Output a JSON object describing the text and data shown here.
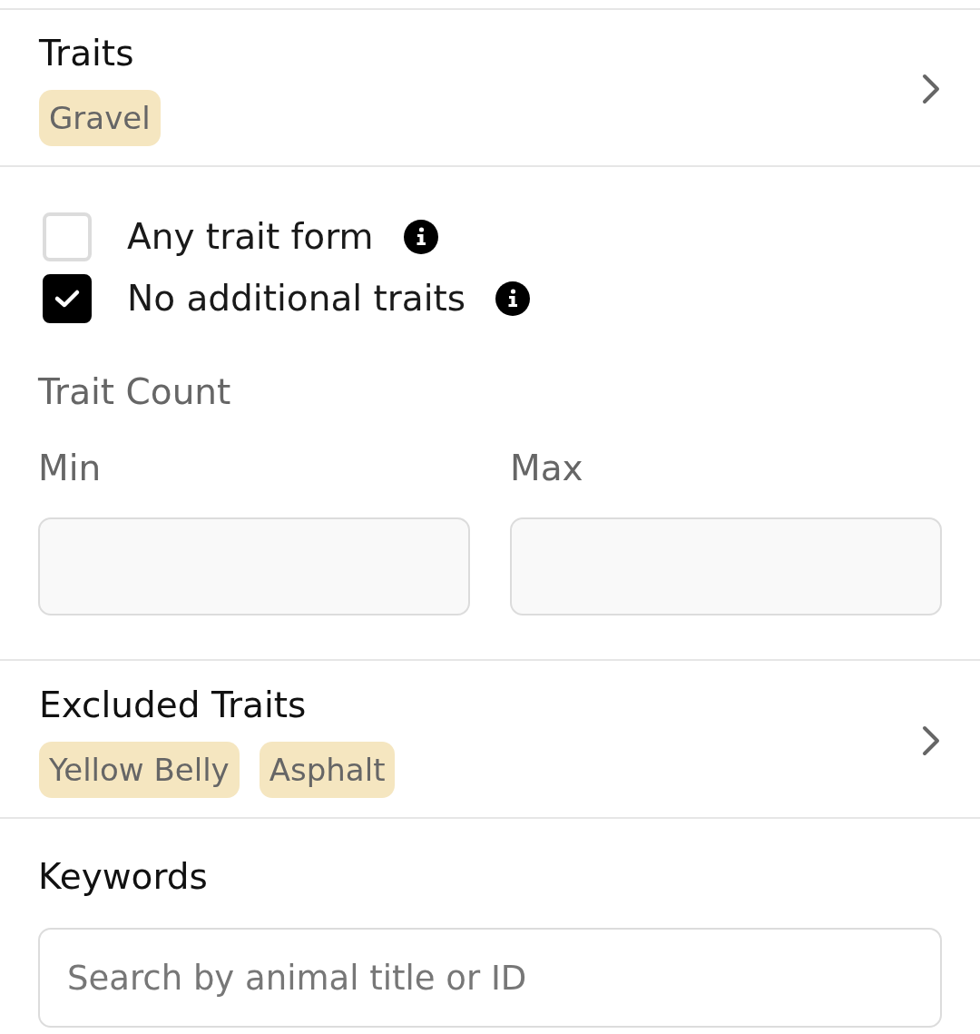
{
  "traits": {
    "title": "Traits",
    "tags": [
      "Gravel"
    ]
  },
  "options": [
    {
      "label": "Any trait form",
      "checked": false
    },
    {
      "label": "No additional traits",
      "checked": true
    }
  ],
  "trait_count": {
    "title": "Trait Count",
    "fields": [
      {
        "label": "Min"
      },
      {
        "label": "Max"
      }
    ]
  },
  "excluded_traits": {
    "title": "Excluded Traits",
    "tags": [
      "Yellow Belly",
      "Asphalt"
    ]
  },
  "keywords": {
    "title": "Keywords",
    "placeholder": "Search by animal title or ID"
  }
}
